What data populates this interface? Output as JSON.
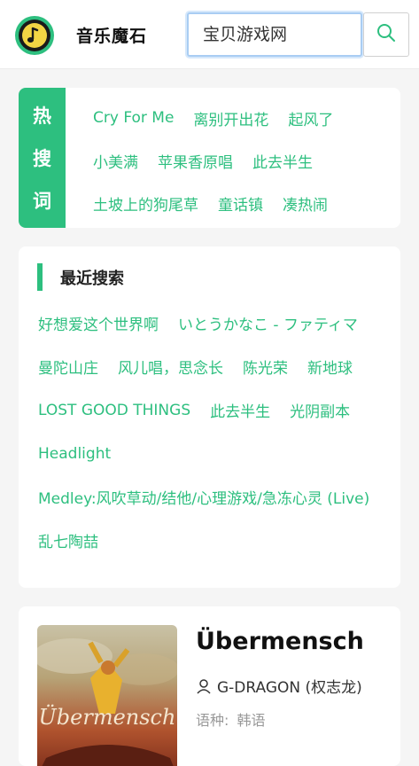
{
  "header": {
    "app_title": "音乐魔石",
    "search_value": "宝贝游戏网"
  },
  "hot_search": {
    "label_chars": [
      "热",
      "搜",
      "词"
    ],
    "rows": [
      [
        "Cry For Me",
        "离别开出花",
        "起风了"
      ],
      [
        "小美满",
        "苹果香原唱",
        "此去半生"
      ],
      [
        "土坡上的狗尾草",
        "童话镇",
        "凑热闹"
      ]
    ]
  },
  "recent_search": {
    "title": "最近搜索",
    "rows": [
      [
        "好想爱这个世界啊",
        "いとうかなこ - ファティマ"
      ],
      [
        "曼陀山庄",
        "风儿唱，思念长",
        "陈光荣",
        "新地球"
      ],
      [
        "LOST GOOD THINGS",
        "此去半生",
        "光阴副本"
      ],
      [
        "Headlight"
      ],
      [
        "Medley:风吹草动/结他/心理游戏/急冻心灵 (Live)"
      ],
      [
        "乱七陶喆"
      ]
    ]
  },
  "song": {
    "title": "Übermensch",
    "artist": "G-DRAGON (权志龙)",
    "language_label": "语种:",
    "language_value": "韩语",
    "cover_text": "Übermensch"
  },
  "colors": {
    "accent": "#2dbf7f",
    "background": "#f5f5f5"
  },
  "icons": {
    "logo": "music-note-icon",
    "search": "search-icon",
    "artist": "user-icon"
  }
}
